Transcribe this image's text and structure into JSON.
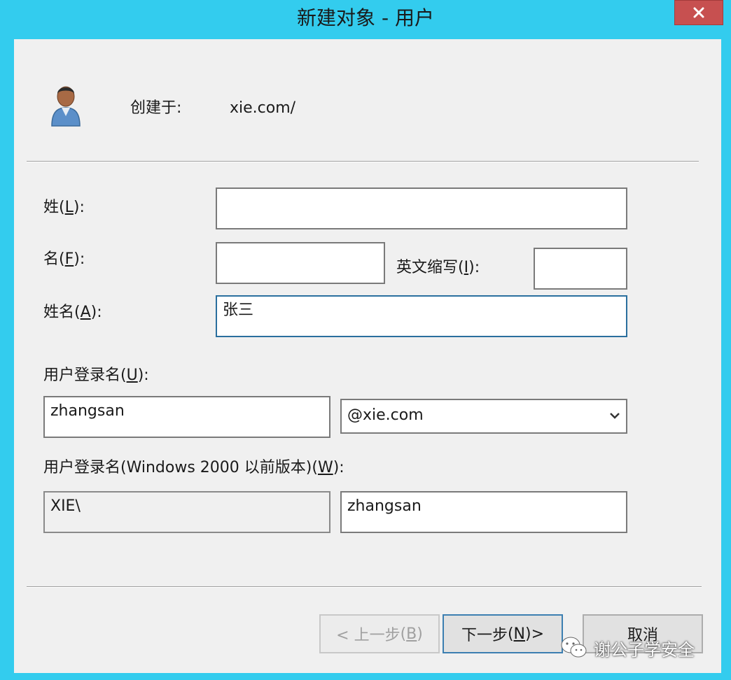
{
  "window": {
    "title": "新建对象 - 用户",
    "close_icon": "close-icon",
    "accent_color": "#33ccee"
  },
  "header": {
    "icon": "user-icon",
    "created_in_label": "创建于:",
    "created_in_value": "xie.com/"
  },
  "form": {
    "last_name_label": "姓",
    "last_name_key": "L",
    "last_name_value": "",
    "first_name_label": "名",
    "first_name_key": "F",
    "first_name_value": "",
    "initials_label": "英文缩写",
    "initials_key": "I",
    "initials_value": "",
    "full_name_label": "姓名",
    "full_name_key": "A",
    "full_name_value": "张三",
    "logon_label": "用户登录名",
    "logon_key": "U",
    "logon_value": "zhangsan",
    "domain_selected": "@xie.com",
    "pre2000_label": "用户登录名(Windows 2000 以前版本)",
    "pre2000_key": "W",
    "pre2000_domain": "XIE\\",
    "pre2000_value": "zhangsan"
  },
  "buttons": {
    "back_label": "< 上一步",
    "back_key": "B",
    "next_label": "下一步",
    "next_key": "N",
    "next_suffix": " >",
    "cancel_label": "取消"
  },
  "watermark": {
    "text": "谢公子学安全",
    "icon": "wechat-icon"
  }
}
